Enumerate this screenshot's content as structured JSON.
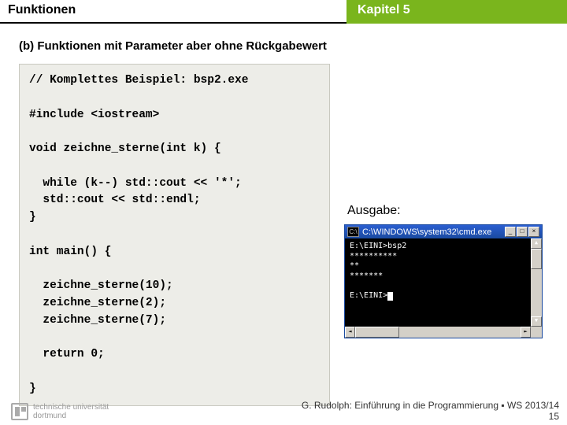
{
  "header": {
    "left": "Funktionen",
    "right": "Kapitel 5"
  },
  "subtitle": "(b) Funktionen mit Parameter aber ohne Rückgabewert",
  "code": "// Komplettes Beispiel: bsp2.exe\n\n#include <iostream>\n\nvoid zeichne_sterne(int k) {\n\n  while (k--) std::cout << '*';\n  std::cout << std::endl;\n}\n\nint main() {\n\n  zeichne_sterne(10);\n  zeichne_sterne(2);\n  zeichne_sterne(7);\n\n  return 0;\n\n}",
  "side": {
    "label": "Ausgabe:"
  },
  "console": {
    "title": "C:\\WINDOWS\\system32\\cmd.exe",
    "icon_text": "C:\\",
    "buttons": {
      "min": "_",
      "max": "□",
      "close": "×"
    },
    "output": "E:\\EINI>bsp2\n**********\n**\n*******\n\nE:\\EINI>"
  },
  "footer": {
    "line": "G. Rudolph: Einführung in die Programmierung ▪ WS 2013/14",
    "page": "15",
    "uni1": "technische universität",
    "uni2": "dortmund"
  }
}
